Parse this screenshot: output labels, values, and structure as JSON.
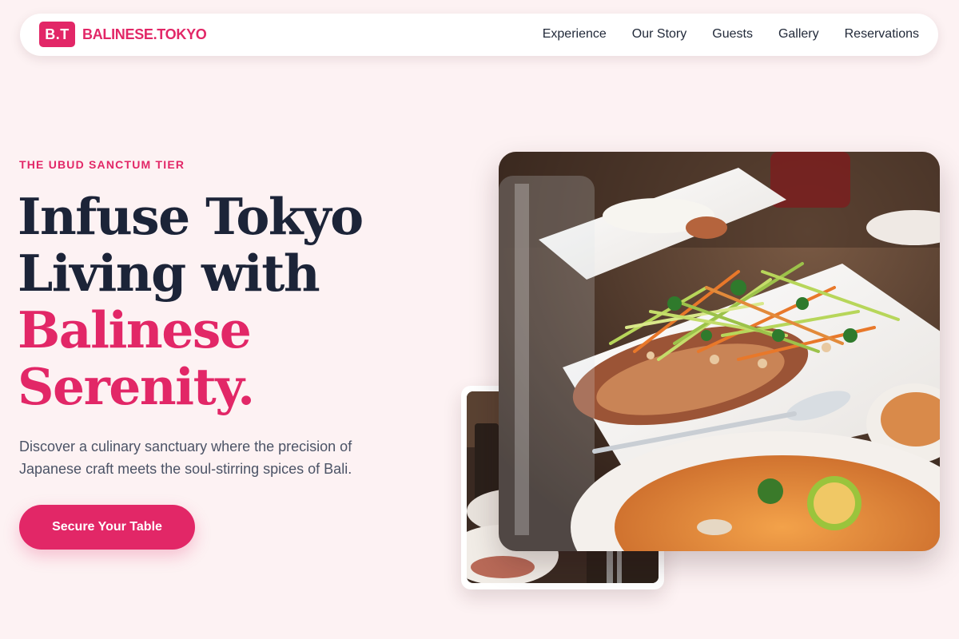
{
  "brand": {
    "mark": "B.T",
    "name": "BALINESE.TOKYO",
    "accent_color": "#e22767"
  },
  "nav": {
    "links": [
      "Experience",
      "Our Story",
      "Guests",
      "Gallery",
      "Reservations"
    ]
  },
  "hero": {
    "eyebrow": "THE UBUD SANCTUM TIER",
    "headline_lines": [
      "Infuse Tokyo",
      "Living with"
    ],
    "headline_accent_lines": [
      "Balinese",
      "Serenity."
    ],
    "subcopy": "Discover a culinary sanctuary where the precision of Japanese craft meets the soul-stirring spices of Bali.",
    "cta_label": "Secure Your Table"
  },
  "colors": {
    "background": "#fdf2f3",
    "text_dark": "#1c2438",
    "accent": "#e22767"
  }
}
